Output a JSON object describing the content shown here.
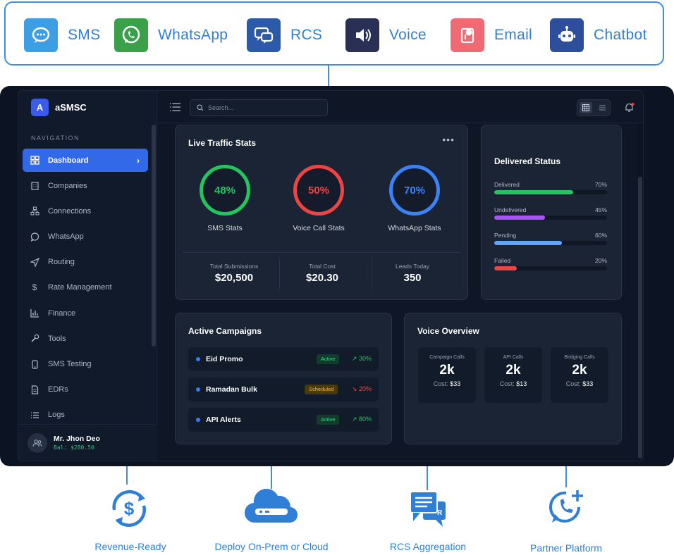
{
  "channels": [
    {
      "label": "SMS",
      "icon": "sms-chat-icon",
      "color": "#3d9ee4"
    },
    {
      "label": "WhatsApp",
      "icon": "whatsapp-icon",
      "color": "#3ba04a"
    },
    {
      "label": "RCS",
      "icon": "rcs-chat-icon",
      "color": "#2d5aa8"
    },
    {
      "label": "Voice",
      "icon": "speaker-icon",
      "color": "#2a2f55"
    },
    {
      "label": "Email",
      "icon": "email-icon",
      "color": "#ef6a72"
    },
    {
      "label": "Chatbot",
      "icon": "robot-icon",
      "color": "#2d4e9b"
    }
  ],
  "app": {
    "brand_letter": "A",
    "brand_name": "aSMSC",
    "nav_heading": "NAVIGATION",
    "nav_items": [
      {
        "label": "Dashboard",
        "icon": "dashboard-icon",
        "active": true
      },
      {
        "label": "Companies",
        "icon": "building-icon"
      },
      {
        "label": "Connections",
        "icon": "network-icon"
      },
      {
        "label": "WhatsApp",
        "icon": "chat-bubble-icon"
      },
      {
        "label": "Routing",
        "icon": "send-icon"
      },
      {
        "label": "Rate Management",
        "icon": "dollar-icon"
      },
      {
        "label": "Finance",
        "icon": "bar-chart-icon"
      },
      {
        "label": "Tools",
        "icon": "wrench-icon"
      },
      {
        "label": "SMS Testing",
        "icon": "phone-icon"
      },
      {
        "label": "EDRs",
        "icon": "document-icon"
      },
      {
        "label": "Logs",
        "icon": "list-icon"
      }
    ],
    "user_name": "Mr. Jhon Deo",
    "user_balance": "Bal: $280.50",
    "search_placeholder": "Search..."
  },
  "traffic": {
    "title": "Live Traffic Stats",
    "rings": [
      {
        "value": "48%",
        "label": "SMS Stats",
        "color": "#22c55e"
      },
      {
        "value": "50%",
        "label": "Voice Call Stats",
        "color": "#ef4444"
      },
      {
        "value": "70%",
        "label": "WhatsApp Stats",
        "color": "#3b82f6"
      }
    ],
    "stats": [
      {
        "label": "Total Submissions",
        "value": "$20,500"
      },
      {
        "label": "Total Cost",
        "value": "$20.30"
      },
      {
        "label": "Leads Today",
        "value": "350"
      }
    ]
  },
  "delivered": {
    "title": "Delivered Status",
    "bars": [
      {
        "label": "Delivered",
        "value": "70%",
        "fraction": 0.7,
        "color": "#22c55e"
      },
      {
        "label": "Undelivered",
        "value": "45%",
        "fraction": 0.45,
        "color": "#a855f7"
      },
      {
        "label": "Pending",
        "value": "60%",
        "fraction": 0.6,
        "color": "#60a5fa"
      },
      {
        "label": "Failed",
        "value": "20%",
        "fraction": 0.2,
        "color": "#ef4444"
      }
    ]
  },
  "campaigns": {
    "title": "Active Campaigns",
    "items": [
      {
        "name": "Eid Promo",
        "status": "Active",
        "trend": "↗ 30%",
        "trend_color": "#22c55e",
        "badge_bg": "#123d2a",
        "badge_fg": "#34d399"
      },
      {
        "name": "Ramadan Bulk",
        "status": "Scheduled",
        "trend": "↘ 20%",
        "trend_color": "#ef4444",
        "badge_bg": "#473a0c",
        "badge_fg": "#f2b735"
      },
      {
        "name": "API Alerts",
        "status": "Active",
        "trend": "↗ 80%",
        "trend_color": "#22c55e",
        "badge_bg": "#123d2a",
        "badge_fg": "#34d399"
      }
    ]
  },
  "voice": {
    "title": "Voice Overview",
    "boxes": [
      {
        "label": "Campaign Calls",
        "value": "2k",
        "cost_label": "Cost:",
        "cost": "$33"
      },
      {
        "label": "API Calls",
        "value": "2k",
        "cost_label": "Cost:",
        "cost": "$13"
      },
      {
        "label": "Bridging Calls",
        "value": "2k",
        "cost_label": "Cost:",
        "cost": "$33"
      }
    ]
  },
  "features": [
    {
      "label": "Revenue-Ready",
      "icon": "dollar-cycle-icon"
    },
    {
      "label": "Deploy On-Prem or Cloud",
      "icon": "cloud-server-icon"
    },
    {
      "label": "RCS Aggregation",
      "icon": "rcs-messages-icon"
    },
    {
      "label": "Partner Platform",
      "icon": "phone-plus-icon"
    }
  ]
}
